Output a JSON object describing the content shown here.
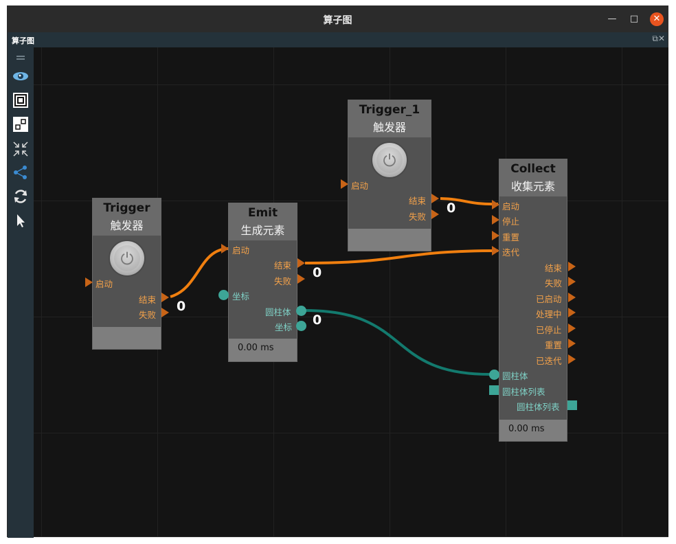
{
  "window": {
    "title": "算子图",
    "min": "—",
    "max": "□",
    "close": "✕"
  },
  "panel": {
    "title": "算子图",
    "controls": "⧉✕"
  },
  "toolbar": [
    "handle-icon",
    "eye-icon",
    "frame-icon",
    "nodes-icon",
    "collapse-icon",
    "graph-icon",
    "refresh-icon",
    "pointer-icon"
  ],
  "nodes": {
    "trigger": {
      "name": "Trigger",
      "sub": "触发器",
      "in_start": "启动",
      "out_end": "结束",
      "out_fail": "失败"
    },
    "emit": {
      "name": "Emit",
      "sub": "生成元素",
      "in_start": "启动",
      "out_end": "结束",
      "out_fail": "失败",
      "in_coord": "坐标",
      "out_cyl": "圆柱体",
      "out_coord": "坐标",
      "time": "0.00 ms"
    },
    "trigger1": {
      "name": "Trigger_1",
      "sub": "触发器",
      "in_start": "启动",
      "out_end": "结束",
      "out_fail": "失败"
    },
    "collect": {
      "name": "Collect",
      "sub": "收集元素",
      "in_start": "启动",
      "in_stop": "停止",
      "in_reset": "重置",
      "in_iter": "迭代",
      "out_end": "结束",
      "out_fail": "失败",
      "out_started": "已启动",
      "out_processing": "处理中",
      "out_stopped": "已停止",
      "out_reset": "重置",
      "out_iterated": "已迭代",
      "in_cyl": "圆柱体",
      "in_cyl_list": "圆柱体列表",
      "out_cyl_list": "圆柱体列表",
      "time": "0.00 ms"
    }
  },
  "wires": {
    "w1": "0",
    "w2": "0",
    "w3": "0",
    "w4": "0"
  },
  "colors": {
    "orange": "#f07f0f",
    "teal": "#137a6e",
    "port_orange": "#c86417",
    "port_teal": "#3da597"
  }
}
